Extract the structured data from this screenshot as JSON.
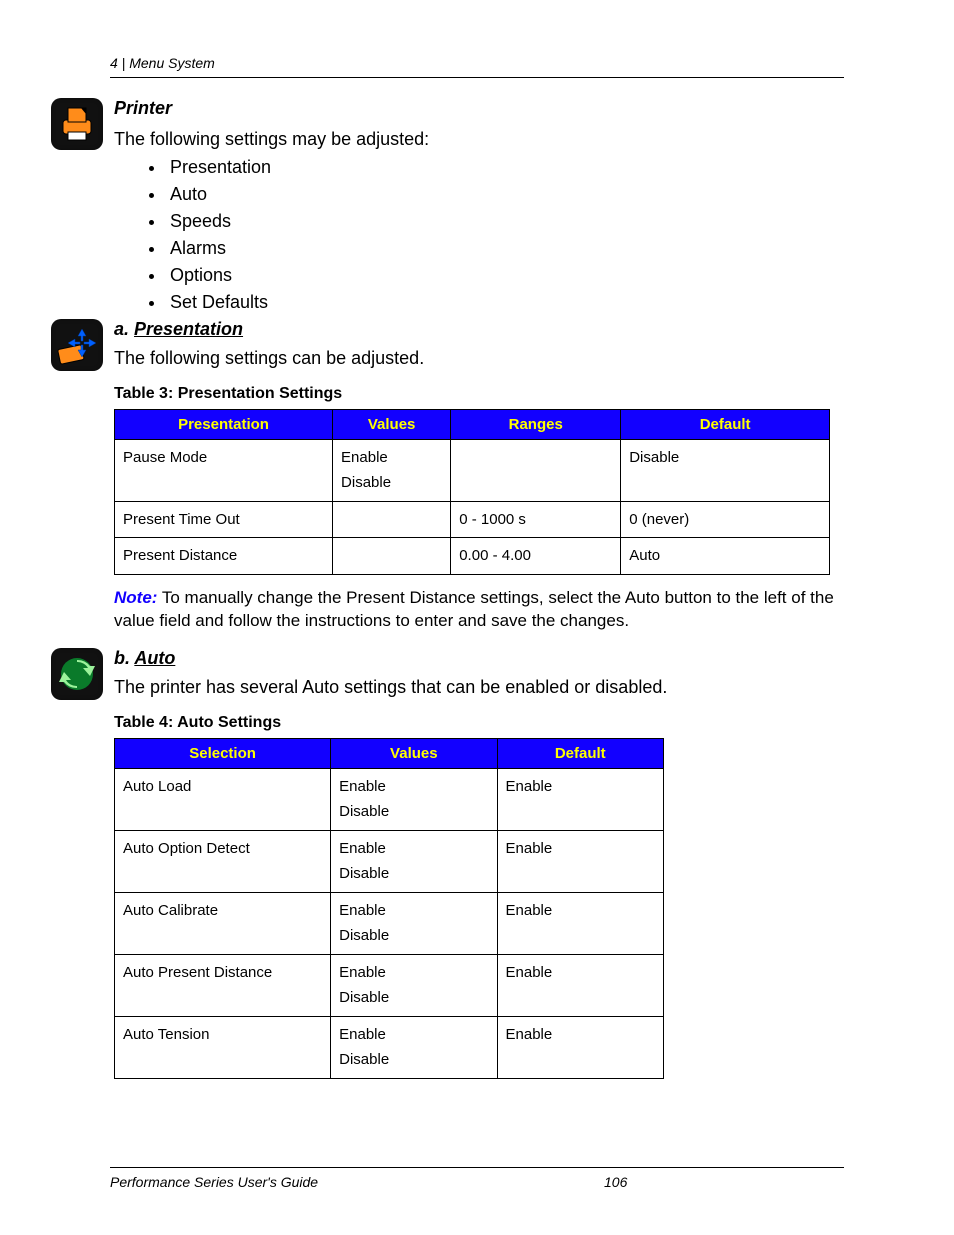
{
  "header": {
    "chapter_num": "4",
    "sep": "   |   ",
    "chapter_title": "Menu System"
  },
  "printer": {
    "title": "Printer",
    "intro": "The following settings may be adjusted:",
    "items": [
      "Presentation",
      "Auto",
      "Speeds",
      "Alarms",
      "Options",
      "Set Defaults"
    ]
  },
  "presentation": {
    "prefix": "a. ",
    "title": "Presentation",
    "intro": "The following settings can be adjusted.",
    "table_caption": "Table 3: Presentation Settings",
    "headers": [
      "Presentation",
      "Values",
      "Ranges",
      "Default"
    ],
    "rows": [
      {
        "c0": "Pause Mode",
        "c1": "Enable\nDisable",
        "c2": "",
        "c3": "Disable"
      },
      {
        "c0": "Present Time Out",
        "c1": "",
        "c2": "0 - 1000 s",
        "c3": "0 (never)"
      },
      {
        "c0": "Present Distance",
        "c1": "",
        "c2": "0.00 - 4.00",
        "c3": "Auto"
      }
    ]
  },
  "note": {
    "label": "Note:",
    "text": " To manually change the Present Distance settings, select the Auto button to the left of the value field and follow the instructions to enter and save the changes."
  },
  "auto": {
    "prefix": "b. ",
    "title": "Auto",
    "intro": "The printer has several Auto settings that can be enabled or disabled.",
    "table_caption": "Table 4: Auto Settings",
    "headers": [
      "Selection",
      "Values",
      "Default"
    ],
    "rows": [
      {
        "c0": "Auto Load",
        "c1": "Enable\nDisable",
        "c2": "Enable"
      },
      {
        "c0": "Auto Option Detect",
        "c1": "Enable\nDisable",
        "c2": "Enable"
      },
      {
        "c0": "Auto Calibrate",
        "c1": "Enable\nDisable",
        "c2": "Enable"
      },
      {
        "c0": "Auto Present Distance",
        "c1": "Enable\nDisable",
        "c2": "Enable"
      },
      {
        "c0": "Auto Tension",
        "c1": "Enable\nDisable",
        "c2": "Enable"
      }
    ]
  },
  "footer": {
    "left": "Performance Series User's Guide",
    "page": "106"
  }
}
